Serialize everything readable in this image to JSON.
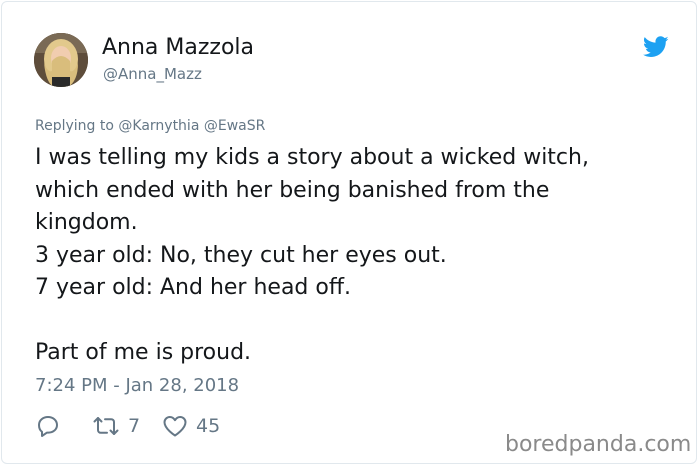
{
  "author": {
    "display_name": "Anna Mazzola",
    "handle": "@Anna_Mazz"
  },
  "icons": {
    "brand": "twitter-bird-icon",
    "reply": "reply-icon",
    "retweet": "retweet-icon",
    "like": "heart-icon"
  },
  "colors": {
    "twitter_blue": "#1da1f2",
    "secondary_text": "#657786",
    "primary_text": "#14171a"
  },
  "reply_context": {
    "prefix": "Replying to",
    "users": "@Karnythia @EwaSR"
  },
  "tweet": {
    "lines": [
      "I was telling my kids a story about a wicked witch,",
      "which ended with her being banished from the",
      "kingdom.",
      "3 year old: No, they cut her eyes out.",
      "7 year old: And her head off.",
      "",
      "Part of me is proud."
    ],
    "timestamp": "7:24 PM - Jan 28, 2018"
  },
  "actions": {
    "retweet_count": "7",
    "like_count": "45"
  },
  "watermark": "boredpanda.com"
}
